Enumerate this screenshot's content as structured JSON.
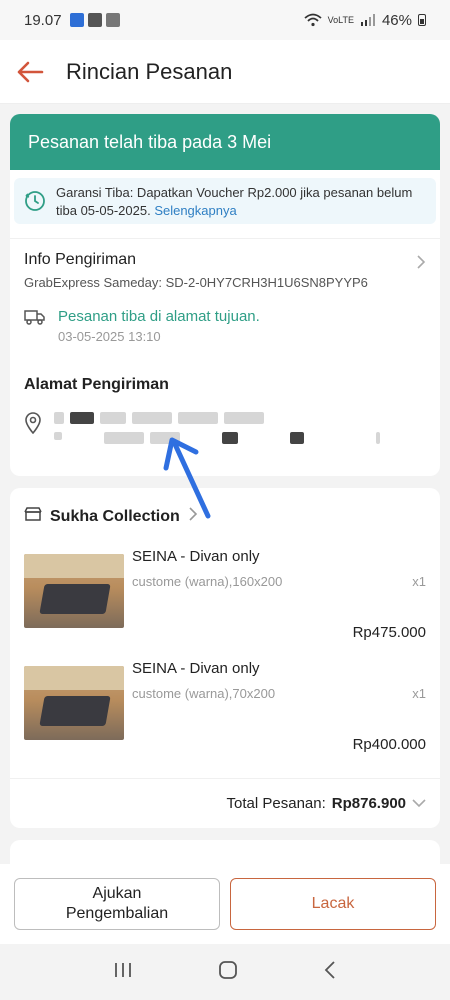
{
  "status_bar": {
    "time": "19.07",
    "network": "VoLTE",
    "battery": "46%"
  },
  "header": {
    "title": "Rincian Pesanan"
  },
  "banner": {
    "text": "Pesanan telah tiba pada 3 Mei"
  },
  "guarantee": {
    "text": "Garansi Tiba: Dapatkan Voucher Rp2.000 jika pesanan belum tiba 05-05-2025.",
    "link": "Selengkapnya"
  },
  "shipping": {
    "title": "Info Pengiriman",
    "courier": "GrabExpress Sameday: SD-2-0HY7CRH3H1U6SN8PYYP6",
    "status": "Pesanan tiba di alamat tujuan.",
    "timestamp": "03-05-2025 13:10"
  },
  "address": {
    "title": "Alamat Pengiriman"
  },
  "store": {
    "name": "Sukha Collection",
    "items": [
      {
        "name": "SEINA - Divan only",
        "variant": "custome (warna),160x200",
        "qty": "x1",
        "price": "Rp475.000"
      },
      {
        "name": "SEINA - Divan only",
        "variant": "custome (warna),70x200",
        "qty": "x1",
        "price": "Rp400.000"
      }
    ],
    "total_label": "Total Pesanan:",
    "total_value": "Rp876.900"
  },
  "actions": {
    "return_label": "Ajukan\nPengembalian",
    "track_label": "Lacak"
  },
  "colors": {
    "accent_green": "#2f9e86",
    "accent_orange": "#c8663f",
    "link_blue": "#2f7fc3",
    "annotation_blue": "#2f6fe0"
  },
  "icons": [
    "back-arrow-icon",
    "clock-check-icon",
    "chevron-right-icon",
    "truck-icon",
    "location-pin-icon",
    "store-icon",
    "chevron-down-icon",
    "recents-icon",
    "home-icon",
    "back-icon"
  ]
}
